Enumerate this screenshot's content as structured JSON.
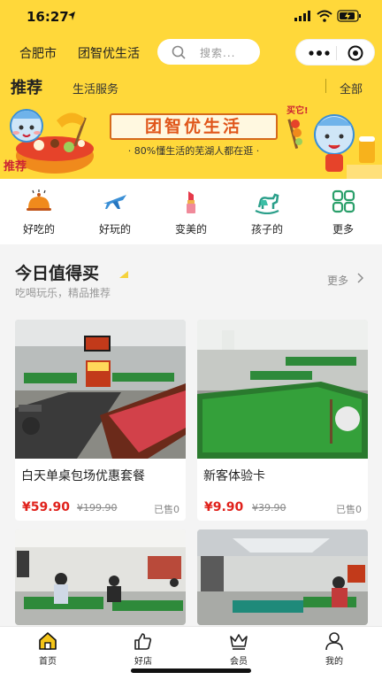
{
  "status_bar": {
    "time": "16:27"
  },
  "header": {
    "city": "合肥市",
    "brand": "团智优生活",
    "search_placeholder": "搜索..."
  },
  "tabs": {
    "active": "推荐",
    "secondary": "生活服务",
    "all": "全部"
  },
  "banner": {
    "title": "团智优生活",
    "subtitle": "· 80%懂生活的芜湖人都在逛 ·"
  },
  "categories": [
    {
      "label": "好吃的",
      "icon": "dish-cloche-icon"
    },
    {
      "label": "好玩的",
      "icon": "airplane-icon"
    },
    {
      "label": "变美的",
      "icon": "lipstick-icon"
    },
    {
      "label": "孩子的",
      "icon": "rocking-horse-icon"
    },
    {
      "label": "更多",
      "icon": "grid-more-icon"
    }
  ],
  "section": {
    "title": "今日值得买",
    "subtitle": "吃喝玩乐，精品推荐",
    "more": "更多"
  },
  "products": [
    {
      "name": "白天单桌包场优惠套餐",
      "price": "¥59.90",
      "original_price": "¥199.90",
      "sold": "已售0"
    },
    {
      "name": "新客体验卡",
      "price": "¥9.90",
      "original_price": "¥39.90",
      "sold": "已售0"
    }
  ],
  "tabbar": [
    {
      "label": "首页",
      "icon": "home-icon"
    },
    {
      "label": "好店",
      "icon": "thumbs-up-icon"
    },
    {
      "label": "会员",
      "icon": "crown-icon"
    },
    {
      "label": "我的",
      "icon": "user-icon"
    }
  ],
  "colors": {
    "brand_yellow": "#ffd83a",
    "price_red": "#e0211b",
    "active_tab_yellow": "#f5c518"
  }
}
